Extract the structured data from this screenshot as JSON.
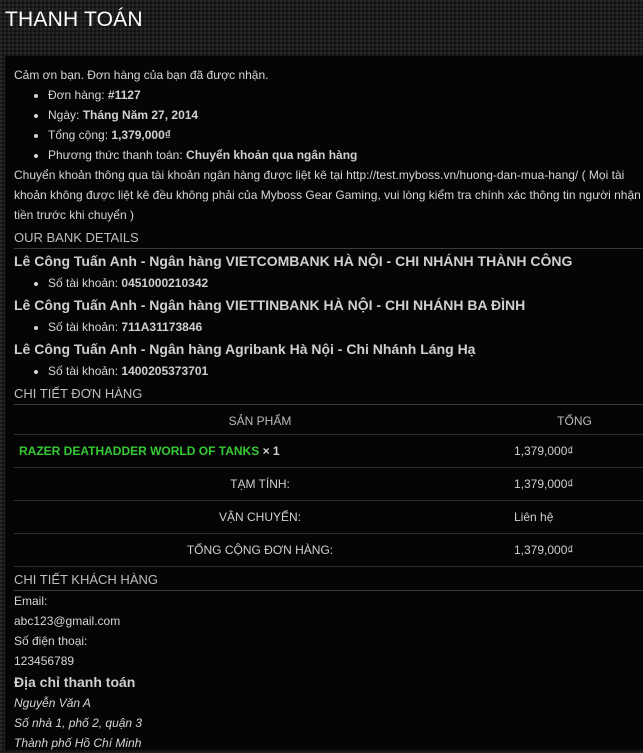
{
  "page_title": "THANH TOÁN",
  "thank_you": "Cảm ơn bạn. Đơn hàng của bạn đã được nhận.",
  "order_summary": [
    {
      "label": "Đơn hàng:",
      "value": "#1127"
    },
    {
      "label": "Ngày:",
      "value": "Tháng Năm 27, 2014"
    },
    {
      "label": "Tổng cộng:",
      "value": "1,379,000₫"
    },
    {
      "label": "Phương thức thanh toán:",
      "value": "Chuyển khoản qua ngân hàng"
    }
  ],
  "transfer_note": "Chuyển khoản thông qua tài khoản ngân hàng được liệt kê tại http://test.myboss.vn/huong-dan-mua-hang/ ( Mọi tài khoản không được liệt kê đều không phải của Myboss Gear Gaming, vui lòng kiểm tra chính xác thông tin người nhận tiền trước khi chuyển )",
  "bank_section_title": "OUR BANK DETAILS",
  "banks": [
    {
      "name": "Lê Công Tuấn Anh - Ngân hàng VIETCOMBANK HÀ NỘI - CHI NHÁNH THÀNH CÔNG",
      "account_label": "Số tài khoản:",
      "account": "0451000210342"
    },
    {
      "name": "Lê Công Tuấn Anh - Ngân hàng VIETTINBANK HÀ NỘI - CHI NHÁNH BA ĐÌNH",
      "account_label": "Số tài khoản:",
      "account": "711A31173846"
    },
    {
      "name": "Lê Công Tuấn Anh - Ngân hàng Agribank Hà Nội - Chi Nhánh Láng Hạ",
      "account_label": "Số tài khoản:",
      "account": "1400205373701"
    }
  ],
  "order_details_title": "CHI TIẾT ĐƠN HÀNG",
  "table": {
    "col_product": "SẢN PHẨM",
    "col_total": "TỔNG",
    "product_name": "RAZER DEATHADDER WORLD OF TANKS",
    "product_qty": "× 1",
    "product_total": "1,379,000₫",
    "rows": [
      {
        "label": "TẠM TÍNH:",
        "value": "1,379,000₫"
      },
      {
        "label": "VẬN CHUYỂN:",
        "value": "Liên hệ"
      },
      {
        "label": "TỔNG CỘNG ĐƠN HÀNG:",
        "value": "1,379,000₫"
      }
    ]
  },
  "customer_title": "CHI TIẾT KHÁCH HÀNG",
  "customer": {
    "email_label": "Email:",
    "email": "abc123@gmail.com",
    "phone_label": "Số điện thoại:",
    "phone": "123456789"
  },
  "billing_title": "Địa chỉ thanh toán",
  "billing": [
    "Nguyễn Văn A",
    "Số nhà 1, phố 2, quận 3",
    "Thành phố Hồ Chí Minh"
  ],
  "colors": {
    "background": "#050505",
    "text": "#d6d6d6",
    "product_link": "#35c935"
  }
}
